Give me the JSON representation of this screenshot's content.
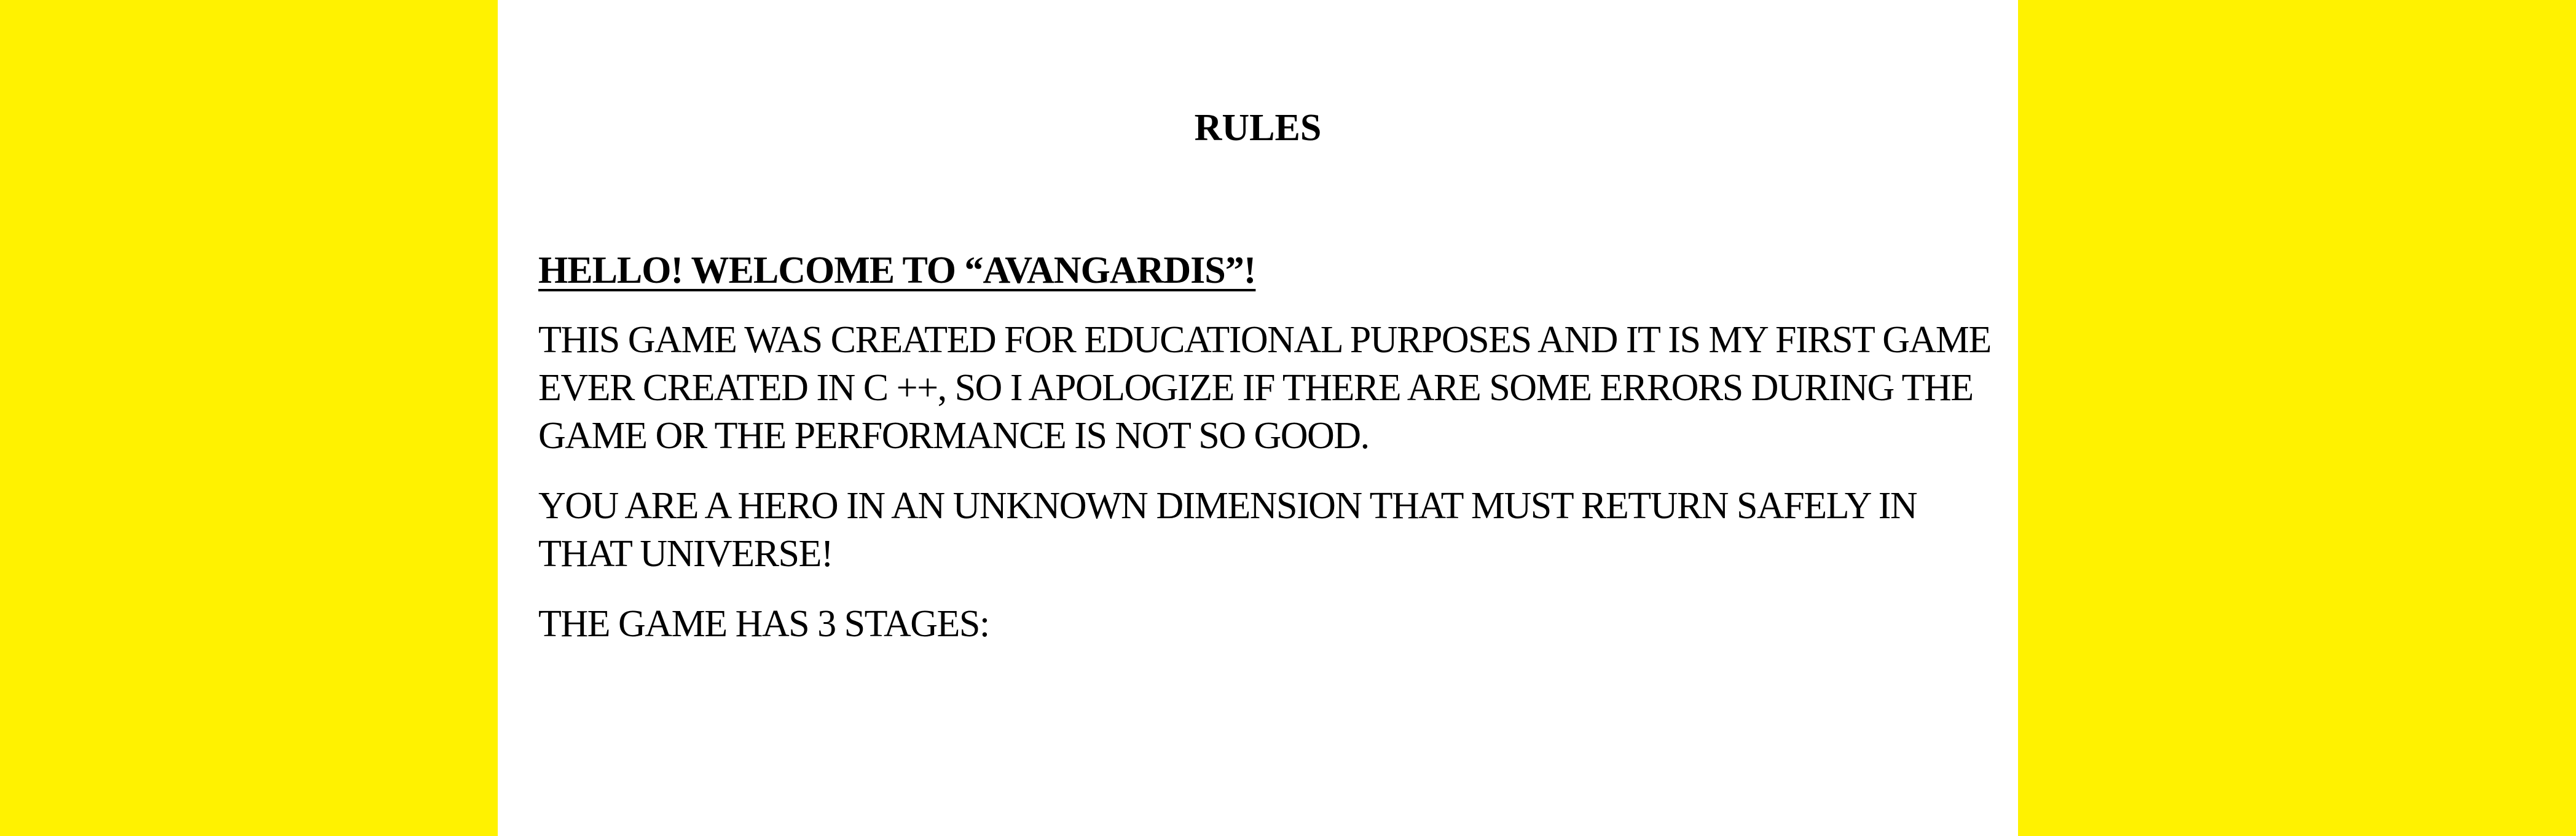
{
  "colors": {
    "background": "#FFF200",
    "page": "#FFFFFF",
    "text": "#000000"
  },
  "rules": {
    "title": "RULES",
    "welcome": "HELLO! WELCOME TO “AVANGARDIS”!",
    "paragraphs": [
      "THIS GAME WAS CREATED FOR EDUCATIONAL PURPOSES AND IT IS MY FIRST GAME EVER CREATED IN C ++, SO I APOLOGIZE IF THERE ARE SOME ERRORS DURING THE GAME OR THE PERFORMANCE IS NOT SO GOOD.",
      "YOU ARE A HERO IN AN UNKNOWN DIMENSION THAT MUST RETURN SAFELY IN THAT UNIVERSE!",
      "THE GAME HAS 3 STAGES:"
    ]
  }
}
